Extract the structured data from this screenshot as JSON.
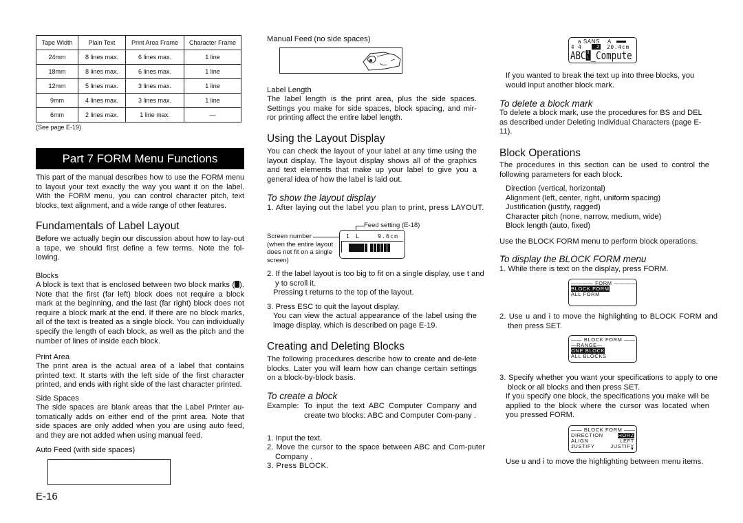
{
  "page_number": "E-16",
  "table": {
    "headers": [
      "Tape Width",
      "Plain Text",
      "Print Area Frame",
      "Character Frame"
    ],
    "rows": [
      [
        "24mm",
        "8 lines max.",
        "6 lines max.",
        "1 line"
      ],
      [
        "18mm",
        "8 lines max.",
        "6 lines max.",
        "1 line"
      ],
      [
        "12mm",
        "5 lines max.",
        "3 lines max.",
        "1 line"
      ],
      [
        "9mm",
        "4 lines max.",
        "3 lines max.",
        "1 line"
      ],
      [
        "6mm",
        "2 lines max.",
        "1 line max.",
        "—"
      ]
    ],
    "note": "(See page E-19)"
  },
  "part_title": "Part 7  FORM Menu Functions",
  "intro": "This part of the manual describes how to use the FORM menu to layout your text exactly the way you want it on the label. With the FORM menu, you can control character pitch, text blocks, text alignment, and a wide range of other features.",
  "fundamentals": {
    "heading": "Fundamentals of Label Layout",
    "intro": "Before we actually begin our discussion about how to lay-out a tape, we should first define a few terms. Note the fol-lowing.",
    "blocks_title": "Blocks",
    "blocks_text_a": "A block is text that is enclosed between two block marks (",
    "blocks_text_b": "). Note that the first (far left) block does not require a block mark at the beginning, and the last (far right) block does not require a block mark at the end. If there are no block marks, all of the text is treated as a single block. You can individually specify the length of each block, as well as the pitch and the number of lines of inside each block.",
    "print_area_title": "Print Area",
    "print_area_text": "The print area is the actual area of a label that contains printed text. It starts with the left side of the first character printed, and ends with right side of the last character printed.",
    "side_spaces_title": "Side Spaces",
    "side_spaces_text": "The side spaces are blank areas that the Label Printer au-tomatically adds on either end of the print area. Note that side spaces are only added when you are using auto feed, and they are not added when using manual feed.",
    "auto_feed_label": "Auto Feed (with side spaces)",
    "manual_feed_label": "Manual Feed (no side spaces)",
    "label_length_title": "Label Length",
    "label_length_text": "The label length is the print area, plus the side spaces. Settings you make for side spaces, block spacing, and mir-ror printing affect the entire label length."
  },
  "layout_display": {
    "heading": "Using the Layout Display",
    "intro": "You can check the layout of your label at any time using the layout display. The layout display shows all of the graphics and text elements that make up your label to give you a general idea of how the label is laid out.",
    "subheading": "To show the layout display",
    "step1": "1. After laying out the label you plan to print, press LAYOUT.",
    "callout_feed": "Feed setting (E-18)",
    "callout_screen": "Screen number",
    "callout_screen_note": "(when the entire layout does not fit on a single screen)",
    "lcd_screen_no": "1",
    "lcd_feed": "L",
    "lcd_length": "9.6cm",
    "step2": "2. If the label layout is too big to fit on a single display, use t and y  to scroll it.",
    "step2_note": "Pressing t   returns to the top of the layout.",
    "step3": "3. Press ESC to quit the layout display.",
    "step3_note": "You can view the actual appearance of the label using the image display, which is described on page E-19."
  },
  "creating_blocks": {
    "heading": "Creating and Deleting Blocks",
    "intro": "The following procedures describe how to create and de-lete blocks. Later you will learn how can change certain settings on a block-by-block basis.",
    "subheading": "To create a block",
    "example_label": "Example:",
    "example_text": "To input the text  ABC Computer Company  and create two blocks:  ABC  and  Computer Com-pany .",
    "steps": [
      "1. Input the text.",
      "2. Move the cursor to the space between  ABC  and  Com-puter Company .",
      "3. Press BLOCK."
    ],
    "lcd": {
      "line1_font": "a SANS",
      "line1_a": "A",
      "line2_left": "4 4",
      "line2_block": "2",
      "line2_length": "20.4cm",
      "line3_text_a": "ABC",
      "line3_text_b": "_Compute",
      "block_mark": "BL"
    },
    "after": "If you wanted to break the text up into three blocks, you would input another block mark.",
    "delete_heading": "To delete a block mark",
    "delete_text": "To delete a block mark, use the procedures for BS and DEL as described under  Deleting Individual Characters  (page E-11)."
  },
  "block_operations": {
    "heading": "Block Operations",
    "intro": "The procedures in this section can be used to control the following parameters for each block.",
    "params": [
      "Direction (vertical, horizontal)",
      "Alignment (left, center, right, uniform spacing)",
      "Justification (justify, ragged)",
      "Character pitch (none, narrow, medium, wide)",
      "Block length (auto, fixed)"
    ],
    "use_menu": "Use the BLOCK FORM menu to perform block operations.",
    "subheading": "To display the BLOCK FORM menu",
    "step1": "1. While there is text on the display, press FORM.",
    "lcd1": {
      "title": "FORM",
      "items": [
        "BLOCK FORM",
        "ALL FORM"
      ],
      "selected": 0
    },
    "step2": "2. Use u   and i    to move the highlighting to  BLOCK FORM  and then press SET.",
    "lcd2": {
      "title": "BLOCK FORM",
      "subtitle": "RANGE",
      "items": [
        "ONE BLOCK",
        "ALL BLOCKS"
      ],
      "selected": 0
    },
    "step3": "3. Specify whether you want your specifications to apply to one block or all blocks and then press SET.",
    "step3_note": "If you specify one block, the specifications you make will be applied to the block where the cursor was located when you pressed FORM.",
    "lcd3": {
      "title": "BLOCK FORM",
      "rows": [
        {
          "label": "DIRECTION",
          "value": "HORZ"
        },
        {
          "label": "ALIGN",
          "value": "LEFT"
        },
        {
          "label": "JUSTIFY",
          "value": "JUSTIFY"
        }
      ]
    },
    "final": "Use u   and i    to move the highlighting between menu items."
  }
}
